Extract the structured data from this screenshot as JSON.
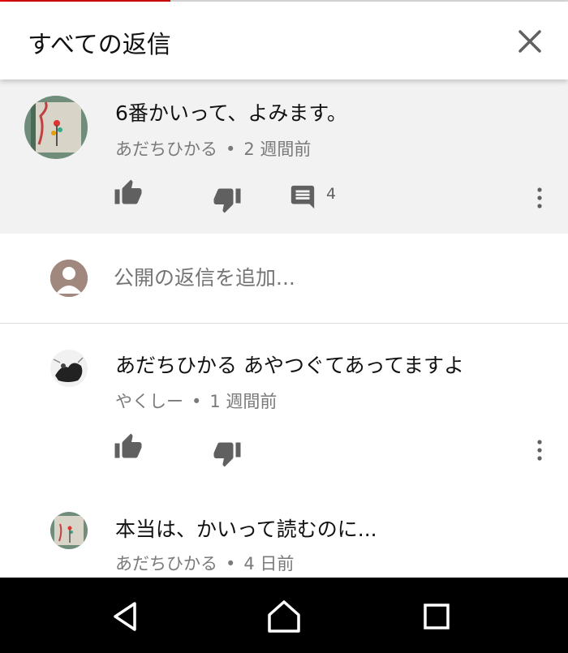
{
  "status": {
    "progress_fraction": 0.3
  },
  "header": {
    "title": "すべての返信",
    "close_icon": "close-icon"
  },
  "parent_comment": {
    "text": "6番かいって、よみます。",
    "author": "あだちひかる",
    "separator": "•",
    "time": "2 週間前",
    "reply_count": "4",
    "icons": [
      "thumb-up-icon",
      "thumb-down-icon",
      "comment-icon",
      "more-vert-icon"
    ]
  },
  "add_reply": {
    "placeholder": "公開の返信を追加..."
  },
  "replies": [
    {
      "text": "あだちひかる あやつぐてあってますよ",
      "author": "やくしー",
      "separator": "•",
      "time": "1 週間前"
    },
    {
      "text": "本当は、かいって読むのに...",
      "author": "あだちひかる",
      "separator": "•",
      "time": "4 日前"
    }
  ],
  "navbar": {
    "icons": [
      "back-icon",
      "home-icon",
      "recents-icon"
    ]
  },
  "colors": {
    "accent": "#cc0000",
    "meta_text": "#7a7a7a",
    "icon": "#606060",
    "parent_bg": "#f2f2f2",
    "navbar_bg": "#000000"
  }
}
